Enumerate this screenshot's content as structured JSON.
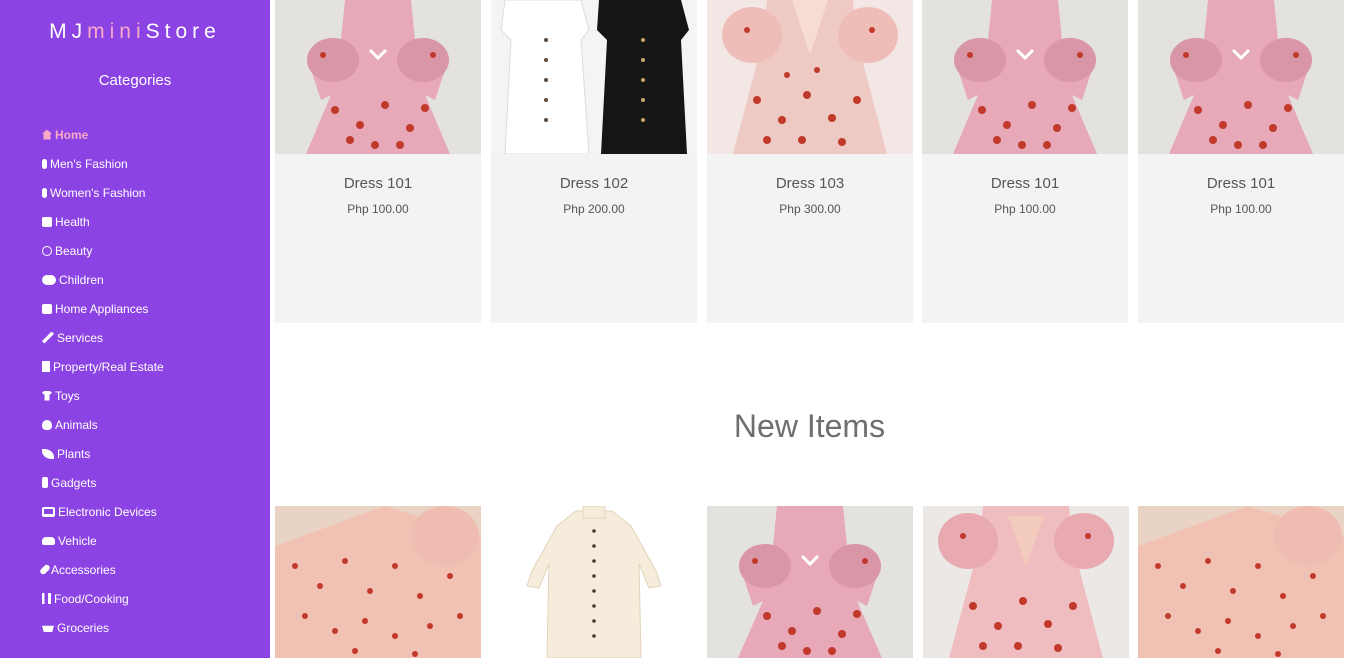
{
  "brand": {
    "part1": "MJ",
    "part2": "mini",
    "part3": "Store"
  },
  "sidebar": {
    "title": "Categories",
    "items": [
      {
        "label": "Home",
        "icon": "home-icon",
        "active": true
      },
      {
        "label": "Men's Fashion",
        "icon": "male-icon"
      },
      {
        "label": "Women's Fashion",
        "icon": "female-icon"
      },
      {
        "label": "Health",
        "icon": "medkit-icon"
      },
      {
        "label": "Beauty",
        "icon": "smile-icon"
      },
      {
        "label": "Children",
        "icon": "users-icon"
      },
      {
        "label": "Home Appliances",
        "icon": "chair-icon"
      },
      {
        "label": "Services",
        "icon": "tools-icon"
      },
      {
        "label": "Property/Real Estate",
        "icon": "building-icon"
      },
      {
        "label": "Toys",
        "icon": "tshirt-icon"
      },
      {
        "label": "Animals",
        "icon": "paw-icon"
      },
      {
        "label": "Plants",
        "icon": "leaf-icon"
      },
      {
        "label": "Gadgets",
        "icon": "mobile-icon"
      },
      {
        "label": "Electronic Devices",
        "icon": "desktop-icon"
      },
      {
        "label": "Vehicle",
        "icon": "car-icon"
      },
      {
        "label": "Accessories",
        "icon": "ring-icon"
      },
      {
        "label": "Food/Cooking",
        "icon": "utensils-icon"
      },
      {
        "label": "Groceries",
        "icon": "basket-icon"
      }
    ]
  },
  "featured": [
    {
      "name": "Dress 101",
      "price": "Php 100.00"
    },
    {
      "name": "Dress 102",
      "price": "Php 200.00"
    },
    {
      "name": "Dress 103",
      "price": "Php 300.00"
    },
    {
      "name": "Dress 101",
      "price": "Php 100.00"
    },
    {
      "name": "Dress 101",
      "price": "Php 100.00"
    }
  ],
  "new_items": {
    "title": "New Items"
  },
  "colors": {
    "sidebar": "#8c43e3",
    "accent": "#f7a9c7",
    "card_bg": "#f3f3f3"
  }
}
